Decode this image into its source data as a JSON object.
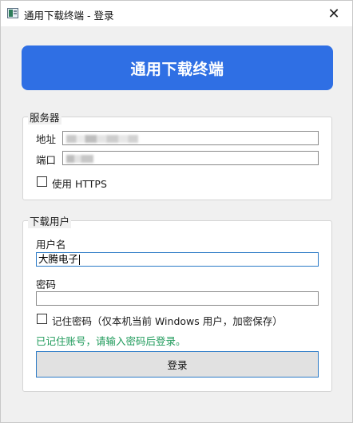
{
  "window": {
    "title": "通用下载终端 - 登录",
    "close_glyph": "✕"
  },
  "banner": {
    "title": "通用下载终端",
    "color": "#2f6fe4"
  },
  "server_group": {
    "title": "服务器",
    "address_label": "地址",
    "port_label": "端口",
    "https_label": "使用 HTTPS",
    "https_checked": false
  },
  "user_group": {
    "title": "下载用户",
    "username_label": "用户名",
    "username_value": "大腾电子",
    "password_label": "密码",
    "password_value": "",
    "remember_label": "记住密码（仅本机当前 Windows 用户，加密保存）",
    "remember_checked": false,
    "hint": "已记住账号，请输入密码后登录。",
    "hint_color": "#1e9a5a",
    "login_button": "登录"
  },
  "icons": {
    "app": "app-window-icon",
    "close": "close-icon",
    "checkbox": "checkbox-icon"
  }
}
